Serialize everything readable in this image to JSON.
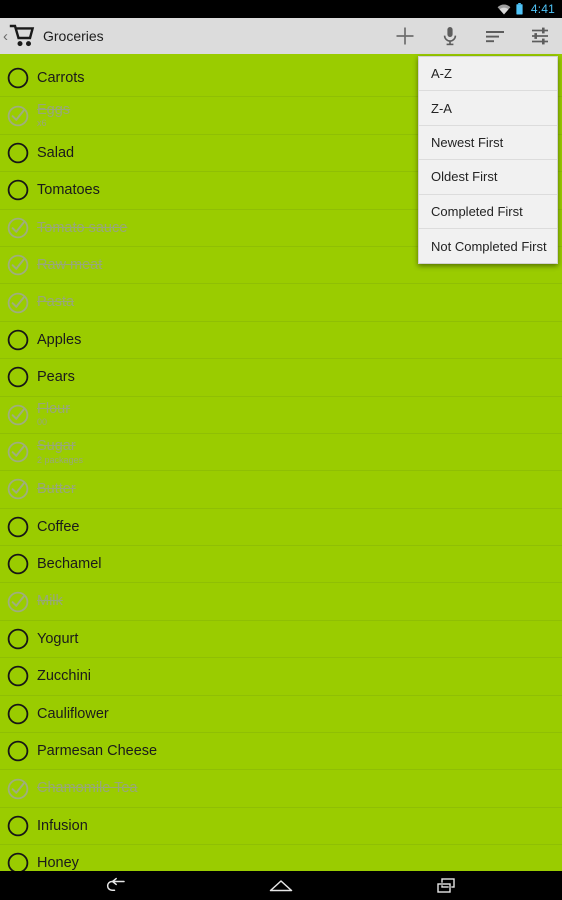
{
  "status_bar": {
    "time": "4:41",
    "wifi_icon": "wifi-icon",
    "battery_icon": "battery-icon",
    "accent_color": "#4FC3F7"
  },
  "action_bar": {
    "back_chevron": "‹",
    "app_icon": "shopping-cart-icon",
    "title": "Groceries",
    "background_color": "#DCDCDC",
    "accent_color": "#9ACC00",
    "actions": [
      {
        "name": "add-item-button",
        "icon": "plus-icon",
        "label": "Add"
      },
      {
        "name": "voice-input-button",
        "icon": "microphone-icon",
        "label": "Voice input"
      },
      {
        "name": "sort-button",
        "icon": "sort-icon",
        "label": "Sort"
      },
      {
        "name": "settings-button",
        "icon": "sliders-icon",
        "label": "Settings"
      }
    ]
  },
  "sort_menu": {
    "visible": true,
    "background_color": "#F1F1F1",
    "items": [
      {
        "label": "A-Z"
      },
      {
        "label": "Z-A"
      },
      {
        "label": "Newest First"
      },
      {
        "label": "Oldest First"
      },
      {
        "label": "Completed First"
      },
      {
        "label": "Not Completed First"
      }
    ]
  },
  "list": {
    "background_color": "#9ACC00",
    "items": [
      {
        "label": "Carrots",
        "sub": "",
        "checked": false
      },
      {
        "label": "Eggs",
        "sub": "x6",
        "checked": true
      },
      {
        "label": "Salad",
        "sub": "",
        "checked": false
      },
      {
        "label": "Tomatoes",
        "sub": "",
        "checked": false
      },
      {
        "label": "Tomato sauce",
        "sub": "",
        "checked": true
      },
      {
        "label": "Raw meat",
        "sub": "",
        "checked": true
      },
      {
        "label": "Pasta",
        "sub": "",
        "checked": true
      },
      {
        "label": "Apples",
        "sub": "",
        "checked": false
      },
      {
        "label": "Pears",
        "sub": "",
        "checked": false
      },
      {
        "label": "Flour",
        "sub": "00",
        "checked": true
      },
      {
        "label": "Sugar",
        "sub": "2 packages",
        "checked": true
      },
      {
        "label": "Butter",
        "sub": "",
        "checked": true
      },
      {
        "label": "Coffee",
        "sub": "",
        "checked": false
      },
      {
        "label": "Bechamel",
        "sub": "",
        "checked": false
      },
      {
        "label": "Milk",
        "sub": "",
        "checked": true
      },
      {
        "label": "Yogurt",
        "sub": "",
        "checked": false
      },
      {
        "label": "Zucchini",
        "sub": "",
        "checked": false
      },
      {
        "label": "Cauliflower",
        "sub": "",
        "checked": false
      },
      {
        "label": "Parmesan Cheese",
        "sub": "",
        "checked": false
      },
      {
        "label": "Chamomile Tea",
        "sub": "",
        "checked": true
      },
      {
        "label": "Infusion",
        "sub": "",
        "checked": false
      },
      {
        "label": "Honey",
        "sub": "",
        "checked": false
      }
    ]
  },
  "nav_bar": {
    "buttons": [
      {
        "name": "nav-back-button",
        "icon": "back-arrow-icon"
      },
      {
        "name": "nav-home-button",
        "icon": "home-icon"
      },
      {
        "name": "nav-recents-button",
        "icon": "recents-icon"
      }
    ]
  }
}
